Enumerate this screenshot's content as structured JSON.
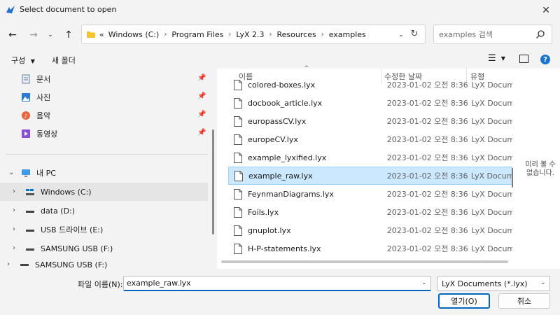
{
  "window": {
    "title": "Select document to open"
  },
  "breadcrumb": {
    "overflow": "«",
    "items": [
      "Windows (C:)",
      "Program Files",
      "LyX 2.3",
      "Resources",
      "examples"
    ]
  },
  "search": {
    "placeholder": "examples 검색"
  },
  "toolbar": {
    "organize": "구성",
    "new_folder": "새 폴더"
  },
  "sidebar": {
    "quick_access": [
      {
        "label": "문서",
        "icon": "document-icon"
      },
      {
        "label": "사진",
        "icon": "pictures-icon"
      },
      {
        "label": "음악",
        "icon": "music-icon"
      },
      {
        "label": "동영상",
        "icon": "videos-icon"
      }
    ],
    "this_pc": "내 PC",
    "drives": [
      {
        "label": "Windows (C:)",
        "selected": true
      },
      {
        "label": "data (D:)"
      },
      {
        "label": "USB 드라이브 (E:)"
      },
      {
        "label": "SAMSUNG USB (F:)"
      },
      {
        "label": "SAMSUNG USB (F:)"
      }
    ]
  },
  "columns": {
    "name": "이름",
    "modified": "수정한 날짜",
    "type": "유형"
  },
  "files": [
    {
      "name": "colored-boxes.lyx",
      "date": "2023-01-02 오전 8:36",
      "type": "LyX Docum"
    },
    {
      "name": "docbook_article.lyx",
      "date": "2023-01-02 오전 8:36",
      "type": "LyX Docum"
    },
    {
      "name": "europassCV.lyx",
      "date": "2023-01-02 오전 8:36",
      "type": "LyX Docum"
    },
    {
      "name": "europeCV.lyx",
      "date": "2023-01-02 오전 8:36",
      "type": "LyX Docum"
    },
    {
      "name": "example_lyxified.lyx",
      "date": "2023-01-02 오전 8:36",
      "type": "LyX Docum"
    },
    {
      "name": "example_raw.lyx",
      "date": "2023-01-02 오전 8:36",
      "type": "LyX Docum",
      "selected": true
    },
    {
      "name": "FeynmanDiagrams.lyx",
      "date": "2023-01-02 오전 8:36",
      "type": "LyX Docum"
    },
    {
      "name": "Foils.lyx",
      "date": "2023-01-02 오전 8:36",
      "type": "LyX Docum"
    },
    {
      "name": "gnuplot.lyx",
      "date": "2023-01-02 오전 8:36",
      "type": "LyX Docum"
    },
    {
      "name": "H-P-statements.lyx",
      "date": "2023-01-02 오전 8:36",
      "type": "LyX Docum"
    }
  ],
  "preview": {
    "line1": "미리 볼 수",
    "line2": "없습니다."
  },
  "footer": {
    "filename_label": "파일 이름(N):",
    "filename_value": "example_raw.lyx",
    "filter": "LyX Documents (*.lyx)",
    "open_button": "열기(O)",
    "cancel_button": "취소"
  },
  "colors": {
    "accent": "#0067c0",
    "selection": "#cce8ff",
    "folder": "#f4c430"
  }
}
